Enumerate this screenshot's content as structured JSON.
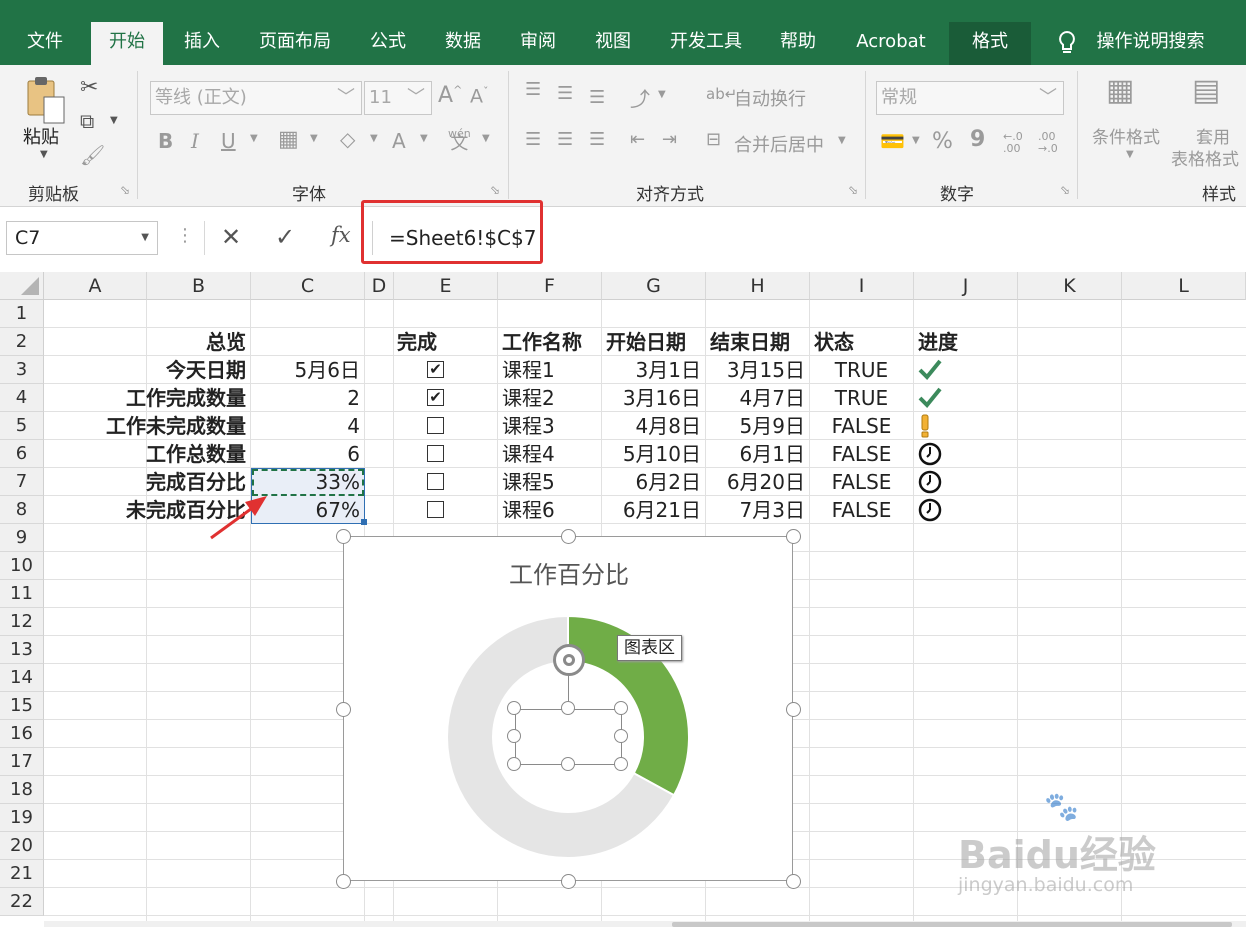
{
  "ribbon_tabs": {
    "file": "文件",
    "home": "开始",
    "insert": "插入",
    "layout": "页面布局",
    "formula": "公式",
    "data": "数据",
    "review": "审阅",
    "view": "视图",
    "dev": "开发工具",
    "help": "帮助",
    "acrobat": "Acrobat",
    "format": "格式",
    "tell": "操作说明搜索"
  },
  "ribbon": {
    "clipboard": {
      "paste": "粘贴",
      "label": "剪贴板"
    },
    "font": {
      "name": "等线 (正文)",
      "size": "11",
      "label": "字体",
      "wen": "wén",
      "wen2": "文"
    },
    "align": {
      "wrap": "自动换行",
      "merge": "合并后居中",
      "label": "对齐方式"
    },
    "number": {
      "format": "常规",
      "label": "数字",
      "pct": "%",
      "comma": "9"
    },
    "styles": {
      "cond": "条件格式",
      "table1": "套用",
      "table2": "表格格式",
      "label": "样式"
    }
  },
  "formula_bar": {
    "name_box": "C7",
    "fx": "fx",
    "formula": "=Sheet6!$C$7"
  },
  "columns": [
    "A",
    "B",
    "C",
    "D",
    "E",
    "F",
    "G",
    "H",
    "I",
    "J",
    "K",
    "L"
  ],
  "rows": [
    "1",
    "2",
    "3",
    "4",
    "5",
    "6",
    "7",
    "8",
    "9",
    "10",
    "11",
    "12",
    "13",
    "14",
    "15",
    "16",
    "17",
    "18",
    "19",
    "20",
    "21",
    "22"
  ],
  "summary": {
    "header": "总览",
    "rows": [
      {
        "label": "今天日期",
        "value": "5月6日"
      },
      {
        "label": "工作完成数量",
        "value": "2"
      },
      {
        "label": "工作未完成数量",
        "value": "4"
      },
      {
        "label": "工作总数量",
        "value": "6"
      },
      {
        "label": "完成百分比",
        "value": "33%"
      },
      {
        "label": "未完成百分比",
        "value": "67%"
      }
    ]
  },
  "table": {
    "headers": {
      "done": "完成",
      "name": "工作名称",
      "start": "开始日期",
      "end": "结束日期",
      "status": "状态",
      "progress": "进度"
    },
    "rows": [
      {
        "done": true,
        "name": "课程1",
        "start": "3月1日",
        "end": "3月15日",
        "status": "TRUE",
        "icon": "check-icon"
      },
      {
        "done": true,
        "name": "课程2",
        "start": "3月16日",
        "end": "4月7日",
        "status": "TRUE",
        "icon": "check-icon"
      },
      {
        "done": false,
        "name": "课程3",
        "start": "4月8日",
        "end": "5月9日",
        "status": "FALSE",
        "icon": "exclamation-icon"
      },
      {
        "done": false,
        "name": "课程4",
        "start": "5月10日",
        "end": "6月1日",
        "status": "FALSE",
        "icon": "clock-icon"
      },
      {
        "done": false,
        "name": "课程5",
        "start": "6月2日",
        "end": "6月20日",
        "status": "FALSE",
        "icon": "clock-icon"
      },
      {
        "done": false,
        "name": "课程6",
        "start": "6月21日",
        "end": "7月3日",
        "status": "FALSE",
        "icon": "clock-icon"
      }
    ]
  },
  "chart": {
    "tooltip": "图表区",
    "colors": {
      "done": "#70ad47",
      "remaining": "#e5e5e5"
    }
  },
  "chart_data": {
    "type": "pie",
    "title": "工作百分比",
    "categories": [
      "完成百分比",
      "未完成百分比"
    ],
    "values": [
      0.33,
      0.67
    ]
  },
  "watermark": {
    "line1": "Baidu经验",
    "line2": "jingyan.baidu.com"
  },
  "colors": {
    "accent": "#217346",
    "highlight": "#e03131"
  }
}
